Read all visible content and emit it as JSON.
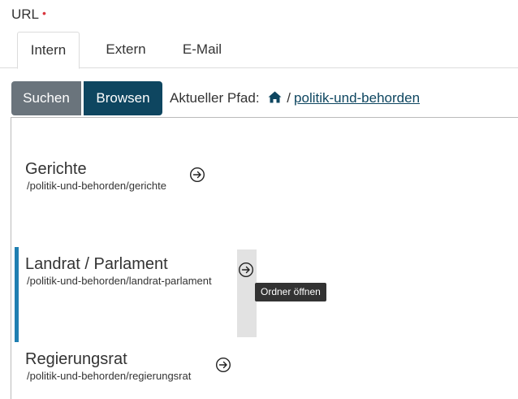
{
  "field": {
    "label": "URL",
    "required_marker": "•"
  },
  "tabs": [
    {
      "label": "Intern",
      "active": true
    },
    {
      "label": "Extern",
      "active": false
    },
    {
      "label": "E-Mail",
      "active": false
    }
  ],
  "mode_buttons": {
    "search_label": "Suchen",
    "browse_label": "Browsen"
  },
  "path": {
    "prefix": "Aktueller Pfad:",
    "home_icon": "home-icon",
    "separator": "/",
    "current": "politik-und-behorden"
  },
  "entries": [
    {
      "title": "Gerichte",
      "path": "/politik-und-behorden/gerichte"
    },
    {
      "title": "Landrat / Parlament",
      "path": "/politik-und-behorden/landrat-parlament",
      "selected": true
    },
    {
      "title": "Regierungsrat",
      "path": "/politik-und-behorden/regierungsrat"
    }
  ],
  "tooltip": {
    "text": "Ordner öffnen"
  },
  "colors": {
    "primary": "#0e4660",
    "secondary_button": "#6a747c",
    "selected_bar": "#1f7fb1",
    "required": "#d9363e",
    "tooltip_bg": "#333333"
  }
}
